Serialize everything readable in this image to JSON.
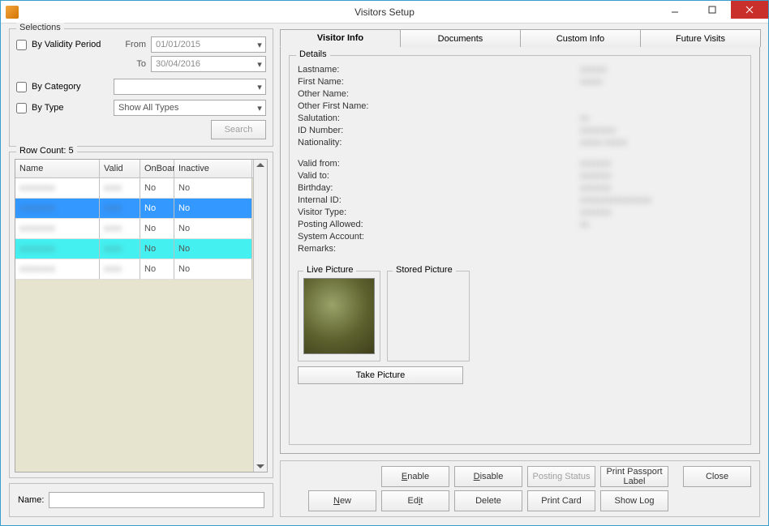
{
  "window": {
    "title": "Visitors Setup"
  },
  "selections": {
    "legend": "Selections",
    "by_validity": "By Validity Period",
    "by_category": "By Category",
    "by_type": "By Type",
    "from_label": "From",
    "to_label": "To",
    "from_value": "01/01/2015",
    "to_value": "30/04/2016",
    "category_value": "",
    "type_value": "Show All Types",
    "search_label": "Search"
  },
  "grid": {
    "legend": "Row Count: 5",
    "headers": {
      "name": "Name",
      "valid": "Valid",
      "onboard": "OnBoard",
      "inactive": "Inactive"
    },
    "rows": [
      {
        "name": "",
        "valid": "",
        "onboard": "No",
        "inactive": "No",
        "state": ""
      },
      {
        "name": "",
        "valid": "",
        "onboard": "No",
        "inactive": "No",
        "state": "sel"
      },
      {
        "name": "",
        "valid": "",
        "onboard": "No",
        "inactive": "No",
        "state": ""
      },
      {
        "name": "",
        "valid": "",
        "onboard": "No",
        "inactive": "No",
        "state": "alt"
      },
      {
        "name": "",
        "valid": "",
        "onboard": "No",
        "inactive": "No",
        "state": ""
      }
    ]
  },
  "name_field": {
    "label": "Name:",
    "value": ""
  },
  "tabs": {
    "visitor_info": "Visitor Info",
    "documents": "Documents",
    "custom_info": "Custom Info",
    "future_visits": "Future Visits"
  },
  "details": {
    "legend": "Details",
    "fields": {
      "lastname": "Lastname:",
      "firstname": "First Name:",
      "othername": "Other Name:",
      "otherfirst": "Other First Name:",
      "salutation": "Salutation:",
      "idnumber": "ID Number:",
      "nationality": "Nationality:",
      "validfrom": "Valid from:",
      "validto": "Valid to:",
      "birthday": "Birthday:",
      "internalid": "Internal ID:",
      "visitortype": "Visitor Type:",
      "posting": "Posting Allowed:",
      "sysacct": "System Account:",
      "remarks": "Remarks:"
    }
  },
  "pictures": {
    "live_legend": "Live Picture",
    "stored_legend": "Stored Picture",
    "take_picture": "Take Picture"
  },
  "footer": {
    "enable": "Enable",
    "disable": "Disable",
    "posting_status": "Posting Status",
    "print_passport": "Print Passport Label",
    "new": "New",
    "edit": "Edit",
    "delete": "Delete",
    "print_card": "Print Card",
    "show_log": "Show Log",
    "close": "Close"
  }
}
